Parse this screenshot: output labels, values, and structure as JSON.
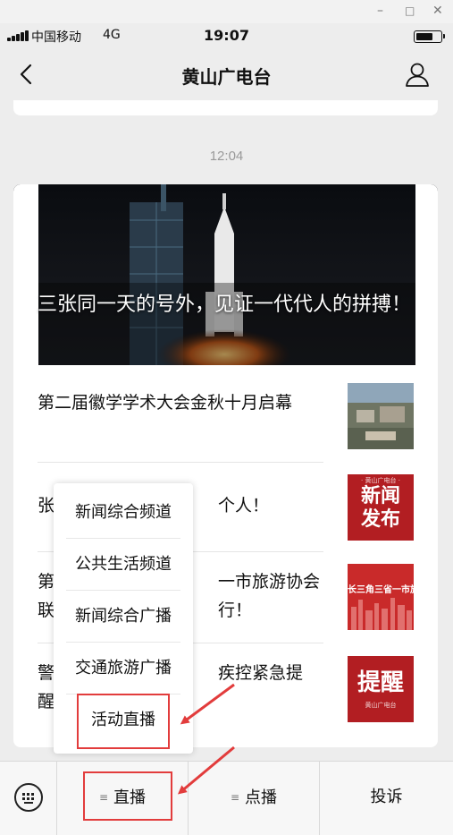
{
  "window": {
    "minimize": "–",
    "maximize": "□",
    "close": "✕"
  },
  "status_bar": {
    "carrier": "中国移动",
    "network": "4G",
    "time": "19:07",
    "battery_percent": 70
  },
  "nav": {
    "title": "黄山广电台",
    "back_icon": "chevron-left-icon",
    "profile_icon": "person-icon"
  },
  "timestamp": "12:04",
  "hero": {
    "title": "三张同一天的号外，见证一代代人的拼搏！"
  },
  "articles": [
    {
      "title": "第二届徽学学术大会金秋十月启幕"
    },
    {
      "title_visible_start": "张",
      "title_visible_end": "个人！"
    },
    {
      "title_line1_start": "第",
      "title_line1_end": "一市旅游协会",
      "title_line2_start": "联",
      "title_line2_end": "行！"
    },
    {
      "title_line1_start": "警",
      "title_line1_end": "疾控紧急提",
      "title_line2_start": "醒"
    }
  ],
  "thumbs": {
    "news_release": [
      "新闻",
      "发布"
    ],
    "three_provinces": [
      "长三角三省一市旅"
    ],
    "reminder": {
      "big": "提醒",
      "small": "黄山广电台"
    }
  },
  "popup_menu": {
    "items": [
      "新闻综合频道",
      "公共生活频道",
      "新闻综合广播",
      "交通旅游广播",
      "活动直播"
    ]
  },
  "bottom_menu": {
    "keyboard_icon": "keyboard-icon",
    "tabs": [
      "直播",
      "点播",
      "投诉"
    ]
  },
  "colors": {
    "annotation_red": "#e23c3c",
    "thumb_red": "#b21e22"
  }
}
